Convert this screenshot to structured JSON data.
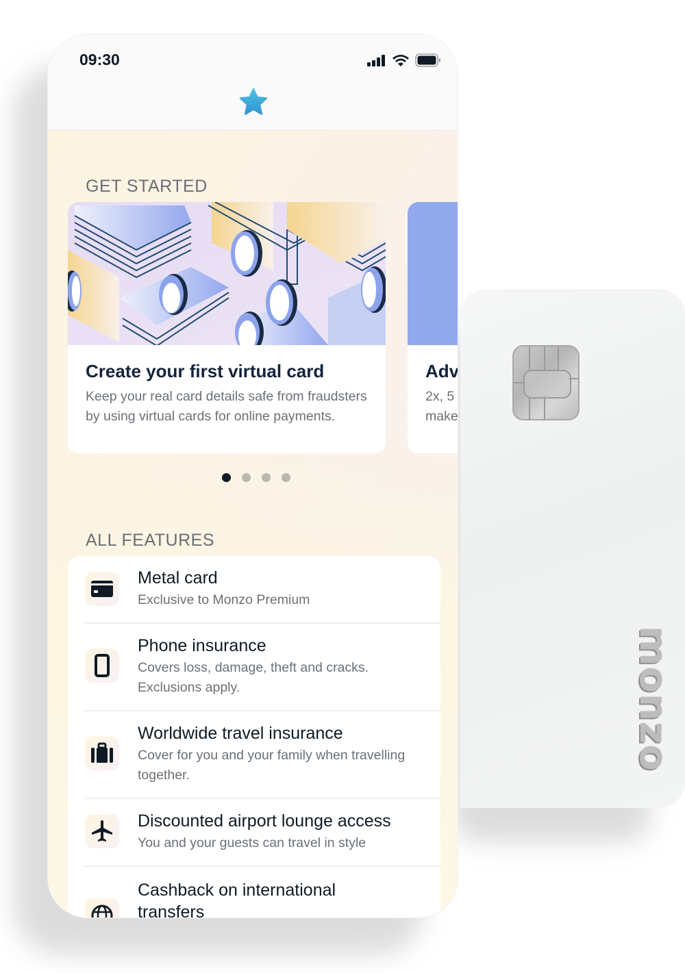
{
  "status_bar": {
    "time": "09:30",
    "icons": [
      "cellular-signal-icon",
      "wifi-icon",
      "battery-icon"
    ]
  },
  "header": {
    "icon": "star-icon",
    "accent_color": "#3aa8dc"
  },
  "get_started": {
    "title": "GET STARTED",
    "cards": [
      {
        "title": "Create your first virtual card",
        "description": "Keep your real card details safe from fraudsters by using virtual cards for online payments."
      },
      {
        "title": "Adv",
        "description": "2x, 5 make"
      }
    ],
    "pagination": {
      "total": 4,
      "active_index": 0
    }
  },
  "all_features": {
    "title": "ALL FEATURES",
    "items": [
      {
        "icon": "credit-card-icon",
        "title": "Metal card",
        "subtitle": "Exclusive to Monzo Premium"
      },
      {
        "icon": "phone-icon",
        "title": "Phone insurance",
        "subtitle": "Covers loss, damage, theft and cracks. Exclusions apply."
      },
      {
        "icon": "luggage-icon",
        "title": "Worldwide travel insurance",
        "subtitle": "Cover for you and your family when travelling together."
      },
      {
        "icon": "airplane-icon",
        "title": "Discounted airport lounge access",
        "subtitle": "You and your guests can travel in style"
      },
      {
        "icon": "globe-icon",
        "title": "Cashback on international transfers",
        "subtitle": ""
      }
    ]
  },
  "metal_card": {
    "brand": "monzo"
  }
}
